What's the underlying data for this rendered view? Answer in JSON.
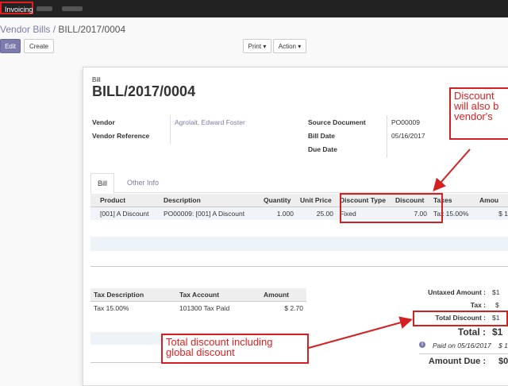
{
  "topbar": {
    "app_name": "Invoicing"
  },
  "breadcrumb": {
    "parent": "Vendor Bills /",
    "current": "BILL/2017/0004"
  },
  "control": {
    "edit": "Edit",
    "create": "Create",
    "print": "Print ▾",
    "action": "Action ▾"
  },
  "sheet": {
    "label": "Bill",
    "number": "BILL/2017/0004"
  },
  "fields": {
    "vendor_label": "Vendor",
    "vendor_value": "Agrolait, Edward Foster",
    "vendor_ref_label": "Vendor Reference",
    "source_doc_label": "Source Document",
    "source_doc_value": "PO00009",
    "bill_date_label": "Bill Date",
    "bill_date_value": "05/16/2017",
    "due_date_label": "Due Date"
  },
  "tabs": [
    "Bill",
    "Other Info"
  ],
  "lines": {
    "headers": [
      "Product",
      "Description",
      "Quantity",
      "Unit Price",
      "Discount Type",
      "Discount",
      "Taxes",
      "Amou"
    ],
    "rows": [
      [
        "[001] A Discount",
        "PO00009: [001] A Discount",
        "1.000",
        "25.00",
        "Fixed",
        "7.00",
        "Tax 15.00%",
        "$ 1"
      ]
    ]
  },
  "tax_table": {
    "headers": [
      "Tax Description",
      "Tax Account",
      "Amount"
    ],
    "rows": [
      [
        "Tax 15.00%",
        "101300 Tax Paid",
        "$ 2.70"
      ]
    ]
  },
  "totals": {
    "untaxed_label": "Untaxed Amount :",
    "untaxed_value": "$1",
    "tax_label": "Tax :",
    "tax_value": "$",
    "discount_label": "Total Discount :",
    "discount_value": "$1",
    "total_label": "Total :",
    "total_value": "$1",
    "paid_text": "Paid on 05/16/2017",
    "paid_value": "$ 1",
    "due_label": "Amount Due :",
    "due_value": "$0"
  },
  "annotations": {
    "top_callout_line1": "Discount",
    "top_callout_line2": "will also b",
    "top_callout_line3": "vendor's",
    "bottom_callout_line1": "Total discount including",
    "bottom_callout_line2": "global discount"
  },
  "colors": {
    "accent": "#7c7bad",
    "annotation": "#d42020"
  }
}
